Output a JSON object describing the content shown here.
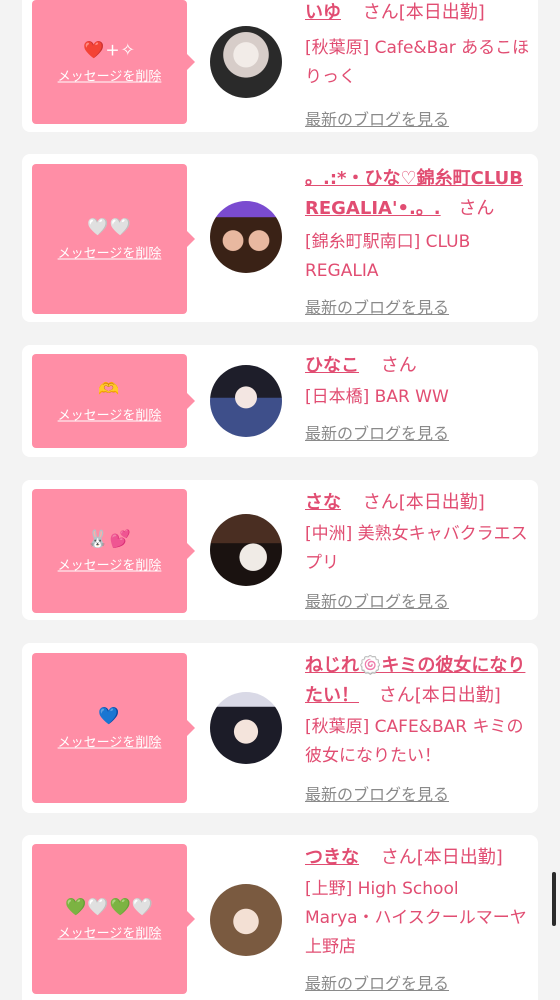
{
  "colors": {
    "accent": "#e14d72",
    "message_box": "#ff8ea6",
    "background": "#f3f3f3",
    "card": "#ffffff",
    "muted_link": "#8a8a8a"
  },
  "cards": [
    {
      "message": "❤️+✧",
      "delete_label": "メッセージを削除",
      "name": "いゆ",
      "honorific": "さん",
      "status": "[本日出勤]",
      "shop": "[秋葉原] Cafe&Bar あるこほりっく",
      "blog_link": "最新のブログを見る"
    },
    {
      "message": "🤍🤍",
      "delete_label": "メッセージを削除",
      "name": "。.:*・ひな♡錦糸町CLUB REGALIA'•.。.",
      "honorific": "さん",
      "status": "",
      "shop": "[錦糸町駅南口] CLUB REGALIA",
      "blog_link": "最新のブログを見る"
    },
    {
      "message": "🫶",
      "delete_label": "メッセージを削除",
      "name": "ひなこ",
      "honorific": "さん",
      "status": "",
      "shop": "[日本橋] BAR WW",
      "blog_link": "最新のブログを見る"
    },
    {
      "message": "🐰💕",
      "delete_label": "メッセージを削除",
      "name": "さな",
      "honorific": "さん",
      "status": "[本日出勤]",
      "shop": "[中洲] 美熟女キャバクラエスプリ",
      "blog_link": "最新のブログを見る"
    },
    {
      "message": "💙",
      "delete_label": "メッセージを削除",
      "name": "ねじれ🍥キミの彼女になりたい！",
      "honorific": "さん",
      "status": "[本日出勤]",
      "shop": "[秋葉原] CAFE&BAR キミの彼女になりたい！",
      "blog_link": "最新のブログを見る"
    },
    {
      "message": "💚🤍💚🤍",
      "delete_label": "メッセージを削除",
      "name": "つきな",
      "honorific": "さん",
      "status": "[本日出勤]",
      "shop": "[上野] High School Marya・ハイスクールマーヤ上野店",
      "blog_link": "最新のブログを見る"
    }
  ]
}
